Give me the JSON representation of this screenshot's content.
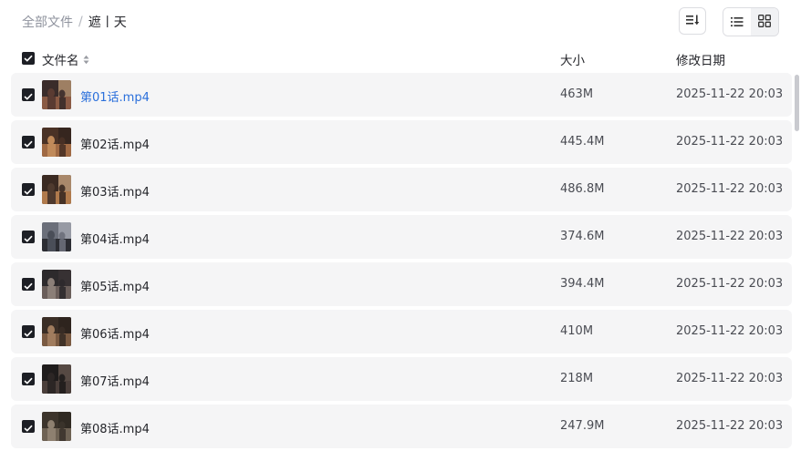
{
  "breadcrumb": {
    "root": "全部文件",
    "separator": "/",
    "current": "遮丨天"
  },
  "toolbar": {
    "sort_icon": "sort-lines-icon",
    "view_list_icon": "list-view-icon",
    "view_grid_icon": "grid-view-icon",
    "active_view": "list"
  },
  "columns": {
    "name": "文件名",
    "size": "大小",
    "modified": "修改日期"
  },
  "header_checked": true,
  "files": [
    {
      "name": "第01话.mp4",
      "size": "463M",
      "modified": "2025-11-22 20:03",
      "checked": true,
      "highlight": true
    },
    {
      "name": "第02话.mp4",
      "size": "445.4M",
      "modified": "2025-11-22 20:03",
      "checked": true,
      "highlight": false
    },
    {
      "name": "第03话.mp4",
      "size": "486.8M",
      "modified": "2025-11-22 20:03",
      "checked": true,
      "highlight": false
    },
    {
      "name": "第04话.mp4",
      "size": "374.6M",
      "modified": "2025-11-22 20:03",
      "checked": true,
      "highlight": false
    },
    {
      "name": "第05话.mp4",
      "size": "394.4M",
      "modified": "2025-11-22 20:03",
      "checked": true,
      "highlight": false
    },
    {
      "name": "第06话.mp4",
      "size": "410M",
      "modified": "2025-11-22 20:03",
      "checked": true,
      "highlight": false
    },
    {
      "name": "第07话.mp4",
      "size": "218M",
      "modified": "2025-11-22 20:03",
      "checked": true,
      "highlight": false
    },
    {
      "name": "第08话.mp4",
      "size": "247.9M",
      "modified": "2025-11-22 20:03",
      "checked": true,
      "highlight": false
    }
  ],
  "colors": {
    "link": "#2a6fdb",
    "row_bg": "#f5f5f6",
    "checkbox": "#1d1f25"
  }
}
